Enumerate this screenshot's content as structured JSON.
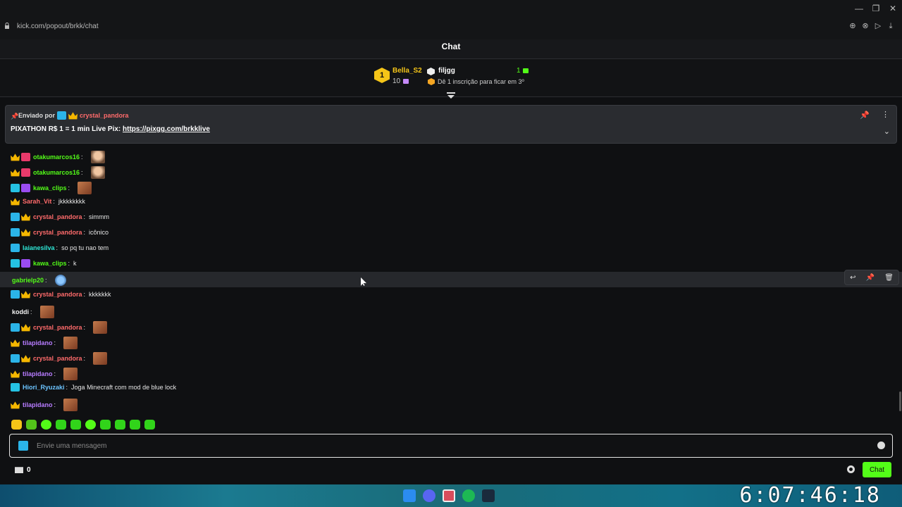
{
  "browser": {
    "url": "kick.com/popout/brkk/chat"
  },
  "chat_header": {
    "title": "Chat"
  },
  "leaderboard": {
    "first": {
      "rank": "1",
      "name": "Bella_S2",
      "count": "10"
    },
    "second": {
      "name": "filjgg",
      "count": "1",
      "hint": "Dê 1 inscrição para ficar em 3º"
    }
  },
  "pinned": {
    "prefix": "Enviado por",
    "author": "crystal_pandora",
    "message": "PIXATHON R$ 1 = 1 min Live Pix: ",
    "link": "https://pixgg.com/brkklive"
  },
  "messages": [
    {
      "user": "otakumarcos16",
      "color": "#53fc18",
      "text": "",
      "emote": "face"
    },
    {
      "user": "otakumarcos16",
      "color": "#53fc18",
      "text": "",
      "emote": "face"
    },
    {
      "user": "kawa_clips",
      "color": "#53fc18",
      "text": "",
      "emote": "img"
    },
    {
      "user": "Sarah_Vit",
      "color": "#ff6b6b",
      "text": "jkkkkkkkk",
      "emote": ""
    },
    {
      "user": "crystal_pandora",
      "color": "#ff6b6b",
      "text": "simmm",
      "emote": ""
    },
    {
      "user": "crystal_pandora",
      "color": "#ff6b6b",
      "text": "icônico",
      "emote": ""
    },
    {
      "user": "laianesilva",
      "color": "#2ee6d6",
      "text": "so pq tu nao tem",
      "emote": ""
    },
    {
      "user": "kawa_clips",
      "color": "#53fc18",
      "text": "k",
      "emote": ""
    },
    {
      "user": "gabrielp20",
      "color": "#53fc18",
      "text": "",
      "emote": "globe"
    },
    {
      "user": "crystal_pandora",
      "color": "#ff6b6b",
      "text": "kkkkkkk",
      "emote": ""
    },
    {
      "user": "koddi",
      "color": "#f5f5f5",
      "text": "",
      "emote": "img"
    },
    {
      "user": "crystal_pandora",
      "color": "#ff6b6b",
      "text": "",
      "emote": "img"
    },
    {
      "user": "tilapidano",
      "color": "#b77cff",
      "text": "",
      "emote": "img"
    },
    {
      "user": "crystal_pandora",
      "color": "#ff6b6b",
      "text": "",
      "emote": "img"
    },
    {
      "user": "tilapidano",
      "color": "#b77cff",
      "text": "",
      "emote": "img"
    },
    {
      "user": "Hiori_Ryuzaki",
      "color": "#6cc4ff",
      "text": "Joga Minecraft com mod de blue lock",
      "emote": ""
    },
    {
      "user": "tilapidano",
      "color": "#b77cff",
      "text": "",
      "emote": "img"
    }
  ],
  "input": {
    "placeholder": "Envie uma mensagem"
  },
  "bottom": {
    "count": "0",
    "send_label": "Chat"
  },
  "taskbar": {
    "clock": "6:07:46:18"
  }
}
